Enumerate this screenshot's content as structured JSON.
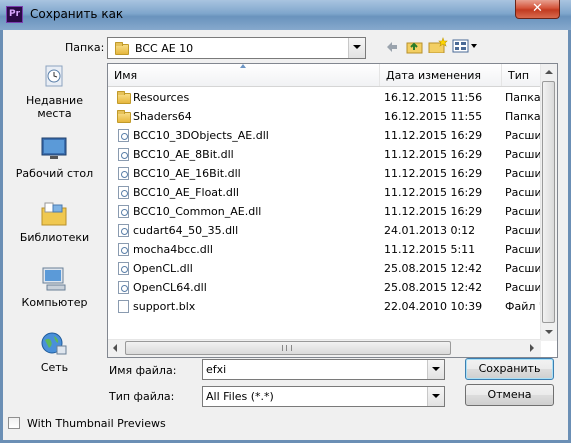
{
  "window": {
    "title": "Сохранить как",
    "app_icon_text": "Pr",
    "close_glyph": "✕"
  },
  "toolbar": {
    "folder_label": "Папка:",
    "folder_value": "BCC AE 10",
    "icons": [
      "back-arrow-icon",
      "up-folder-icon",
      "new-folder-icon",
      "view-menu-icon"
    ]
  },
  "places": [
    {
      "label": "Недавние места",
      "icon": "recent-places-icon"
    },
    {
      "label": "Рабочий стол",
      "icon": "desktop-icon"
    },
    {
      "label": "Библиотеки",
      "icon": "libraries-icon"
    },
    {
      "label": "Компьютер",
      "icon": "computer-icon"
    },
    {
      "label": "Сеть",
      "icon": "network-icon"
    }
  ],
  "columns": {
    "name": "Имя",
    "date": "Дата изменения",
    "type": "Тип"
  },
  "files": [
    {
      "name": "Resources",
      "date": "16.12.2015 11:56",
      "type": "Папка",
      "kind": "folder"
    },
    {
      "name": "Shaders64",
      "date": "16.12.2015 11:55",
      "type": "Папка",
      "kind": "folder"
    },
    {
      "name": "BCC10_3DObjects_AE.dll",
      "date": "11.12.2015 16:29",
      "type": "Расши",
      "kind": "dll"
    },
    {
      "name": "BCC10_AE_8Bit.dll",
      "date": "11.12.2015 16:29",
      "type": "Расши",
      "kind": "dll"
    },
    {
      "name": "BCC10_AE_16Bit.dll",
      "date": "11.12.2015 16:29",
      "type": "Расши",
      "kind": "dll"
    },
    {
      "name": "BCC10_AE_Float.dll",
      "date": "11.12.2015 16:29",
      "type": "Расши",
      "kind": "dll"
    },
    {
      "name": "BCC10_Common_AE.dll",
      "date": "11.12.2015 16:29",
      "type": "Расши",
      "kind": "dll"
    },
    {
      "name": "cudart64_50_35.dll",
      "date": "24.01.2013 0:12",
      "type": "Расши",
      "kind": "dll"
    },
    {
      "name": "mocha4bcc.dll",
      "date": "11.12.2015 5:11",
      "type": "Расши",
      "kind": "dll"
    },
    {
      "name": "OpenCL.dll",
      "date": "25.08.2015 12:42",
      "type": "Расши",
      "kind": "dll"
    },
    {
      "name": "OpenCL64.dll",
      "date": "25.08.2015 12:42",
      "type": "Расши",
      "kind": "dll"
    },
    {
      "name": "support.blx",
      "date": "22.04.2010 10:39",
      "type": "Файл '",
      "kind": "file"
    }
  ],
  "form": {
    "filename_label": "Имя файла:",
    "filename_value": "efxi",
    "filetype_label": "Тип файла:",
    "filetype_value": "All Files (*.*)",
    "save_label": "Сохранить",
    "cancel_label": "Отмена",
    "thumbnail_label": "With Thumbnail Previews"
  }
}
